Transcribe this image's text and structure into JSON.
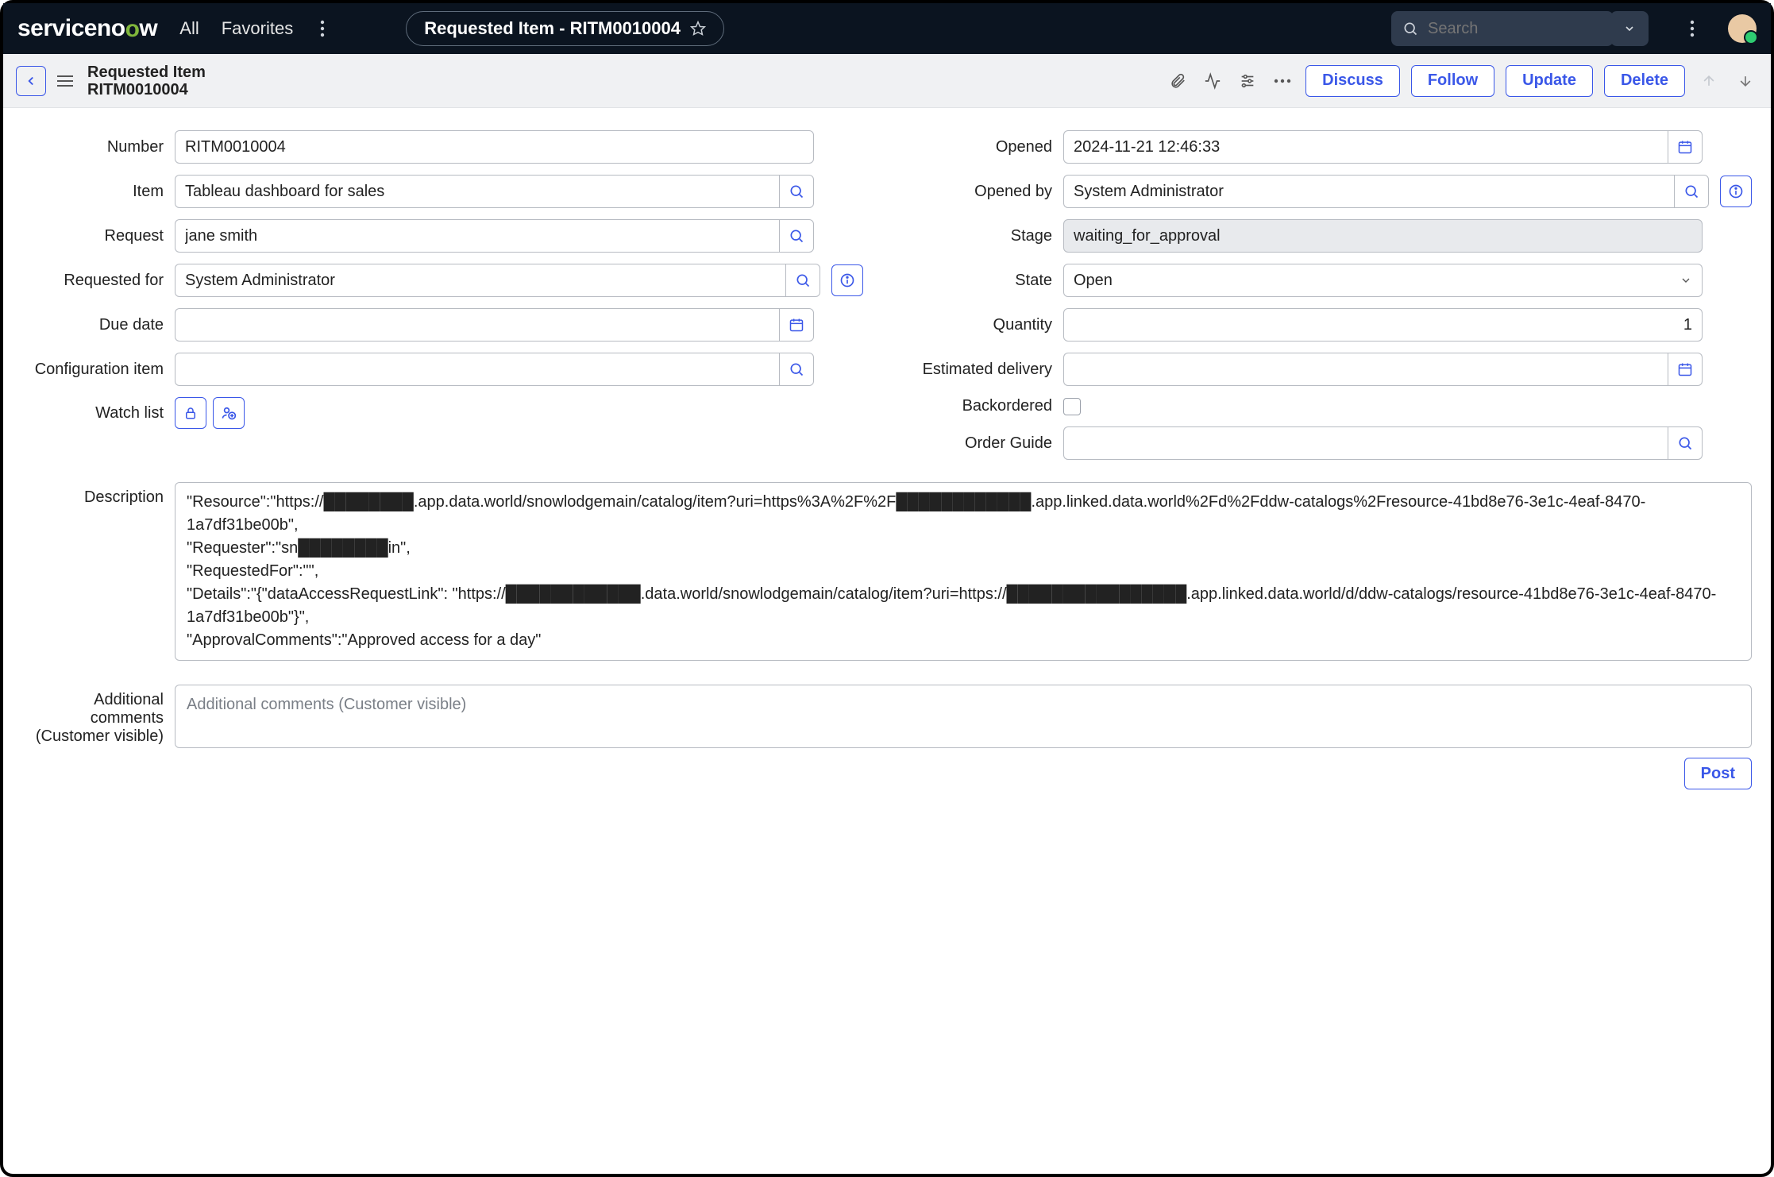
{
  "banner": {
    "logo_text_pre": "serviceno",
    "logo_text_post": "w",
    "menu_all": "All",
    "menu_favorites": "Favorites",
    "breadcrumb": "Requested Item - RITM0010004",
    "search_placeholder": "Search"
  },
  "formbar": {
    "title_line1": "Requested Item",
    "title_line2": "RITM0010004",
    "btn_discuss": "Discuss",
    "btn_follow": "Follow",
    "btn_update": "Update",
    "btn_delete": "Delete"
  },
  "labels": {
    "number": "Number",
    "item": "Item",
    "request": "Request",
    "requested_for": "Requested for",
    "due_date": "Due date",
    "configuration_item": "Configuration item",
    "watch_list": "Watch list",
    "opened": "Opened",
    "opened_by": "Opened by",
    "stage": "Stage",
    "state": "State",
    "quantity": "Quantity",
    "estimated_delivery": "Estimated delivery",
    "backordered": "Backordered",
    "order_guide": "Order Guide",
    "description": "Description",
    "additional_comments_l1": "Additional",
    "additional_comments_l2": "comments",
    "additional_comments_l3": "(Customer visible)"
  },
  "values": {
    "number": "RITM0010004",
    "item": "Tableau dashboard for sales",
    "request": "jane smith",
    "requested_for": "System Administrator",
    "due_date": "",
    "configuration_item": "",
    "opened": "2024-11-21 12:46:33",
    "opened_by": "System Administrator",
    "stage": "waiting_for_approval",
    "state": "Open",
    "quantity": "1",
    "estimated_delivery": "",
    "order_guide": "",
    "description": "\"Resource\":\"https://████████.app.data.world/snowlodgemain/catalog/item?uri=https%3A%2F%2F████████████.app.linked.data.world%2Fd%2Fddw-catalogs%2Fresource-41bd8e76-3e1c-4eaf-8470-1a7df31be00b\",\n\"Requester\":\"sn████████in\",\n\"RequestedFor\":\"\",\n\"Details\":\"{\"dataAccessRequestLink\": \"https://████████████.data.world/snowlodgemain/catalog/item?uri=https://████████████████.app.linked.data.world/d/ddw-catalogs/resource-41bd8e76-3e1c-4eaf-8470-1a7df31be00b\"}\",\n\"ApprovalComments\":\"Approved access for a day\"",
    "additional_comments_placeholder": "Additional comments (Customer visible)"
  },
  "buttons": {
    "post": "Post"
  }
}
